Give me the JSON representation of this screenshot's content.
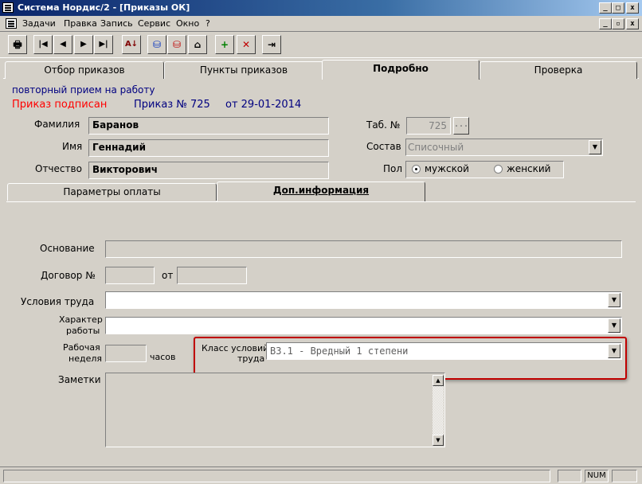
{
  "window": {
    "title": "Система Нордис/2 - [Приказы ОК]",
    "min_glyph": "_",
    "max_glyph": "□",
    "close_glyph": "x",
    "restore_glyph": "▫"
  },
  "menu": [
    "Задачи",
    "Правка",
    "Запись",
    "Сервис",
    "Окно",
    "?"
  ],
  "toolbar": {
    "print_glyph": "🖶",
    "first_glyph": "|◀",
    "prev_glyph": "◀",
    "next_glyph": "▶",
    "last_glyph": "▶|",
    "sort_glyph": "A↓",
    "db_down_glyph": "⛁",
    "db_up_glyph": "⛁",
    "basket_glyph": "⌂",
    "add_glyph": "+",
    "delete_glyph": "✕",
    "exit_glyph": "⇥"
  },
  "tabs": [
    "Отбор приказов",
    "Пункты приказов",
    "Подробно",
    "Проверка"
  ],
  "order": {
    "type": "повторный прием на работу",
    "status": "Приказ подписан",
    "number_label": "Приказ № 725",
    "date_label": "от 29-01-2014"
  },
  "person": {
    "surname_label": "Фамилия",
    "surname": "Баранов",
    "name_label": "Имя",
    "name": "Геннадий",
    "patronymic_label": "Отчество",
    "patronymic": "Викторович",
    "tab_label": "Таб. №",
    "tab_number": "725",
    "tab_btn": "...",
    "composition_label": "Состав",
    "composition": "Списочный",
    "gender_label": "Пол",
    "male": "мужской",
    "female": "женский"
  },
  "subtabs": [
    "Параметры оплаты",
    "Доп.информация"
  ],
  "details": {
    "basis_label": "Основание",
    "contract_label": "Договор №",
    "contract_from": "от",
    "conditions_label": "Условия труда",
    "work_char_label_1": "Характер",
    "work_char_label_2": "работы",
    "week_label_1": "Рабочая",
    "week_label_2": "неделя",
    "hours": "часов",
    "class_label_1": "Класс условий",
    "class_label_2": "труда",
    "class_value": "В3.1 - Вредный 1 степени",
    "notes_label": "Заметки",
    "highlight_color": "#c00000"
  },
  "status": {
    "num": "NUM"
  }
}
